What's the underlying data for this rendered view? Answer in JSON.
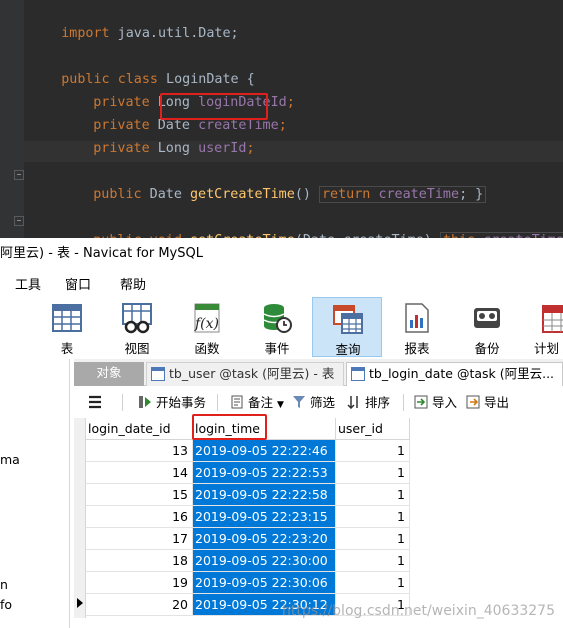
{
  "ide": {
    "code_lines": [
      {
        "kind": "import",
        "keyword": "import",
        "rest": " java.util.Date;"
      },
      {
        "kind": "class",
        "kw1": "public",
        "kw2": "class",
        "rest": " LoginDate {"
      },
      {
        "kind": "field",
        "mod": "private",
        "type": " Long ",
        "name": "loginDateId",
        "end": ";"
      },
      {
        "kind": "field",
        "mod": "private",
        "type": " Date ",
        "name": "createTime",
        "end": ";"
      },
      {
        "kind": "field",
        "mod": "private",
        "type": " Long ",
        "name": "userId",
        "end": ";"
      },
      {
        "kind": "method1",
        "mod": "public",
        "type": " Date ",
        "name": "getCreateTime",
        "params": "()",
        "body_kw": "return",
        "body_field": "createTime",
        "body_end": "; }"
      },
      {
        "kind": "method2",
        "mod": "public",
        "type": " void ",
        "name": "setCreateTime",
        "params": "(Date createTime)",
        "body_kw": "this",
        "body_field": "createTime",
        "body_end": " ="
      }
    ]
  },
  "window": {
    "title": "阿里云) - 表 - Navicat for MySQL"
  },
  "menu": [
    "工具",
    "窗口",
    "帮助"
  ],
  "toolbar": {
    "buttons": [
      {
        "label": "表",
        "icon": "table-icon"
      },
      {
        "label": "视图",
        "icon": "view-icon"
      },
      {
        "label": "函数",
        "icon": "function-icon"
      },
      {
        "label": "事件",
        "icon": "event-icon"
      },
      {
        "label": "查询",
        "icon": "query-icon",
        "active": true
      },
      {
        "label": "报表",
        "icon": "report-icon"
      },
      {
        "label": "备份",
        "icon": "backup-icon"
      },
      {
        "label": "计划",
        "icon": "schedule-icon"
      }
    ]
  },
  "sidebar": {
    "fragments": [
      "ma",
      "n",
      "fo"
    ]
  },
  "tabs": {
    "objects": "对象",
    "tb_user": "tb_user @task (阿里云) - 表",
    "tb_login": "tb_login_date @task (阿里云..."
  },
  "data_toolbar": {
    "menu_icon": "hamburger-icon",
    "begin_transaction": "开始事务",
    "note": "备注",
    "filter": "筛选",
    "sort": "排序",
    "import": "导入",
    "export": "导出"
  },
  "grid": {
    "columns": [
      "login_date_id",
      "login_time",
      "user_id"
    ],
    "rows": [
      {
        "id": "13",
        "time": "2019-09-05 22:22:46",
        "user": "1"
      },
      {
        "id": "14",
        "time": "2019-09-05 22:22:53",
        "user": "1"
      },
      {
        "id": "15",
        "time": "2019-09-05 22:22:58",
        "user": "1"
      },
      {
        "id": "16",
        "time": "2019-09-05 22:23:15",
        "user": "1"
      },
      {
        "id": "17",
        "time": "2019-09-05 22:23:20",
        "user": "1"
      },
      {
        "id": "18",
        "time": "2019-09-05 22:30:00",
        "user": "1"
      },
      {
        "id": "19",
        "time": "2019-09-05 22:30:06",
        "user": "1"
      },
      {
        "id": "20",
        "time": "2019-09-05 22:30:12",
        "user": "1"
      }
    ]
  },
  "watermark": "https://blog.csdn.net/weixin_40633275",
  "colors": {
    "selection": "#0078d7",
    "highlight_box": "#e0201c",
    "ide_background": "#2b2b2b"
  }
}
